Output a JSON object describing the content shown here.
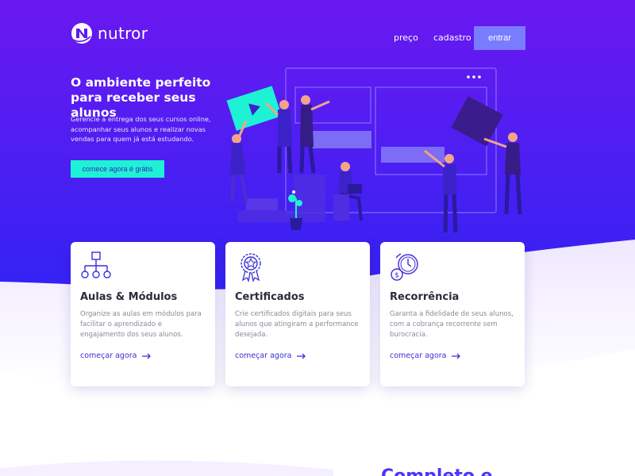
{
  "brand": {
    "name": "nutror"
  },
  "nav": {
    "price": "preço",
    "signup": "cadastro",
    "login": "entrar"
  },
  "hero": {
    "title": "O ambiente perfeito para receber seus alunos",
    "description": "Gerencie a entrega dos seus cursos online, acompanhar seus alunos e realizar novas vendas para quem já está estudando.",
    "cta": "comece agora é grátis"
  },
  "features": [
    {
      "icon": "sitemap-icon",
      "title": "Aulas & Módulos",
      "description": "Organize as aulas em módulos para facilitar o aprendizado e engajamento dos seus alunos.",
      "link": "começar agora"
    },
    {
      "icon": "certificate-icon",
      "title": "Certificados",
      "description": "Crie certificados digitais para seus alunos que atingiram a performance desejada.",
      "link": "começar agora"
    },
    {
      "icon": "recurring-payment-icon",
      "title": "Recorrência",
      "description": "Garanta a fidelidade de seus alunos, com a cobrança recorrente sem burocracia.",
      "link": "começar agora"
    }
  ],
  "section2": {
    "heading": "Completo e"
  },
  "colors": {
    "gradient_start": "#6a18f0",
    "gradient_end": "#3b22f5",
    "accent": "#1ef2d4",
    "button": "#7a7cff",
    "link": "#3b2fd6"
  }
}
